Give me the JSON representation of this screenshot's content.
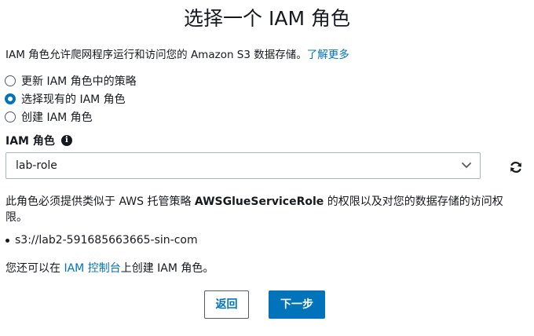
{
  "page": {
    "title": "选择一个 IAM 角色",
    "intro_text": "IAM 角色允许爬网程序运行和访问您的 Amazon S3 数据存储。",
    "learn_more": "了解更多"
  },
  "role_options": [
    {
      "label": "更新 IAM 角色中的策略",
      "selected": false
    },
    {
      "label": "选择现有的 IAM 角色",
      "selected": true
    },
    {
      "label": "创建 IAM 角色",
      "selected": false
    }
  ],
  "iam_role": {
    "label": "IAM 角色",
    "info_icon": "i",
    "selected_value": "lab-role"
  },
  "description": {
    "prefix": "此角色必须提供类似于 AWS 托管策略 ",
    "policy_name": "AWSGlueServiceRole",
    "suffix": " 的权限以及对您的数据存储的访问权限。"
  },
  "data_store_path": "s3://lab2-591685663665-sin-com",
  "console_note": {
    "prefix": "您还可以在 ",
    "link": "IAM 控制台",
    "suffix": "上创建 IAM 角色。"
  },
  "buttons": {
    "back": "返回",
    "next": "下一步"
  },
  "colors": {
    "accent": "#0073bb",
    "text": "#16191f"
  },
  "icons": [
    "info-icon",
    "chevron-down-icon",
    "refresh-icon"
  ]
}
